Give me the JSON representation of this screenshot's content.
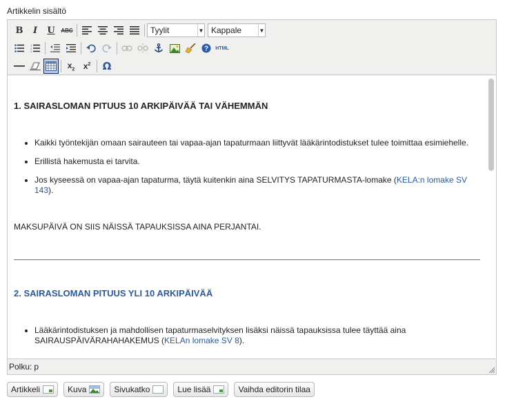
{
  "field_label": "Artikkelin sisältö",
  "toolbar": {
    "styles_select": "Tyylit",
    "format_select": "Kappale",
    "html_label": "HTML",
    "omega": "Ω"
  },
  "content": {
    "heading1": "1. SAIRASLOMAN PITUUS 10 ARKIPÄIVÄÄ TAI VÄHEMMÄN",
    "list1": [
      {
        "text": "Kaikki työntekijän omaan sairauteen tai vapaa-ajan tapaturmaan liittyvät lääkärintodistukset tulee toimittaa esimiehelle."
      },
      {
        "text": "Erillistä hakemusta ei tarvita."
      },
      {
        "text": "Jos kyseessä on vapaa-ajan tapaturma, täytä kuitenkin aina  SELVITYS  TAPATURMASTA-lomake  (",
        "link": "KELA:n lomake SV 143",
        "after": ")."
      }
    ],
    "paragraph": "MAKSUPÄIVÄ ON SIIS NÄISSÄ TAPAUKSISSA AINA PERJANTAI.",
    "heading2": "2. SAIRASLOMAN PITUUS YLI 10 ARKIPÄIVÄÄ",
    "list2": [
      {
        "text": "Lääkärintodistuksen ja mahdollisen tapaturmaselvityksen lisäksi näissä tapauksissa tulee täyttää aina SAIRAUSPÄIVÄRAHAHAKEMUS (",
        "link": "KELAn lomake SV 8",
        "after": ")."
      }
    ]
  },
  "status": {
    "path_label": "Polku:",
    "path_value": "p"
  },
  "buttons": {
    "article": "Artikkeli",
    "image": "Kuva",
    "pagebreak": "Sivukatko",
    "readmore": "Lue lisää",
    "toggle_editor": "Vaihda editorin tilaa"
  },
  "colors": {
    "link": "#2a5a9a",
    "toolbar_bg": "#f0f0ee"
  }
}
